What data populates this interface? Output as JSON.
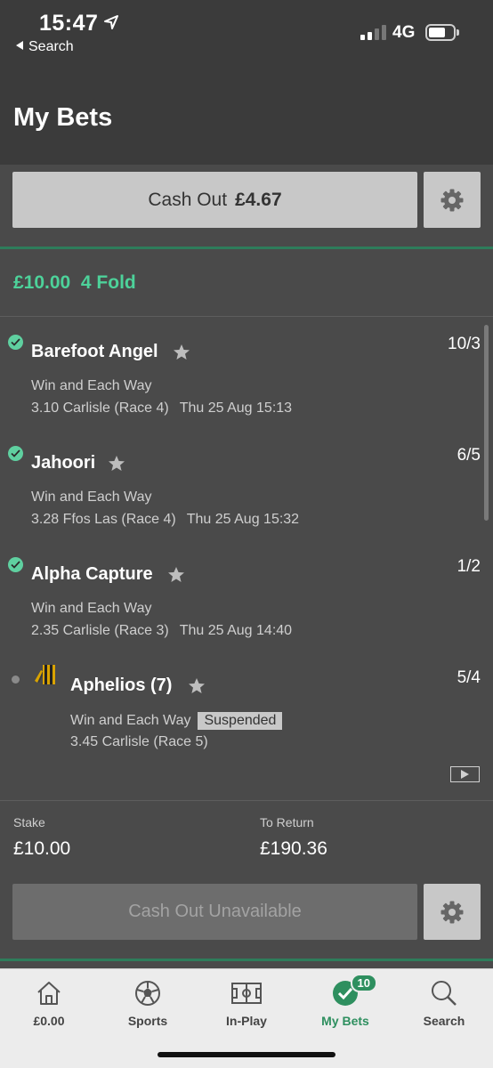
{
  "status_bar": {
    "time": "15:47",
    "back_label": "Search",
    "network": "4G"
  },
  "header": {
    "title": "My Bets"
  },
  "top_cashout": {
    "label": "Cash Out",
    "amount": "£4.67"
  },
  "bet": {
    "title": "£10.00  4 Fold",
    "selections": [
      {
        "name": "Barefoot Angel",
        "odds": "10/3",
        "market": "Win and Each Way",
        "race": "3.10 Carlisle (Race 4)",
        "datetime": "Thu 25 Aug 15:13",
        "status": "won"
      },
      {
        "name": "Jahoori",
        "odds": "6/5",
        "market": "Win and Each Way",
        "race": "3.28 Ffos Las (Race 4)",
        "datetime": "Thu 25 Aug 15:32",
        "status": "won"
      },
      {
        "name": "Alpha Capture",
        "odds": "1/2",
        "market": "Win and Each Way",
        "race": "2.35 Carlisle (Race 3)",
        "datetime": "Thu 25 Aug 14:40",
        "status": "won"
      },
      {
        "name": "Aphelios (7)",
        "odds": "5/4",
        "market": "Win and Each Way",
        "badge": "Suspended",
        "race": "3.45 Carlisle (Race 5)",
        "datetime": "",
        "status": "pending"
      }
    ],
    "stake_label": "Stake",
    "stake": "£10.00",
    "return_label": "To Return",
    "return": "£190.36",
    "cashout_unavailable": "Cash Out Unavailable"
  },
  "nav": {
    "items": [
      {
        "label": "£0.00",
        "icon": "home-icon"
      },
      {
        "label": "Sports",
        "icon": "football-icon"
      },
      {
        "label": "In-Play",
        "icon": "pitch-icon"
      },
      {
        "label": "My Bets",
        "icon": "check-circle-icon",
        "badge": "10",
        "active": true
      },
      {
        "label": "Search",
        "icon": "search-icon"
      }
    ]
  },
  "colors": {
    "accent_green": "#4dd29a",
    "nav_active": "#2e8f5f",
    "background": "#4a4a4a"
  }
}
